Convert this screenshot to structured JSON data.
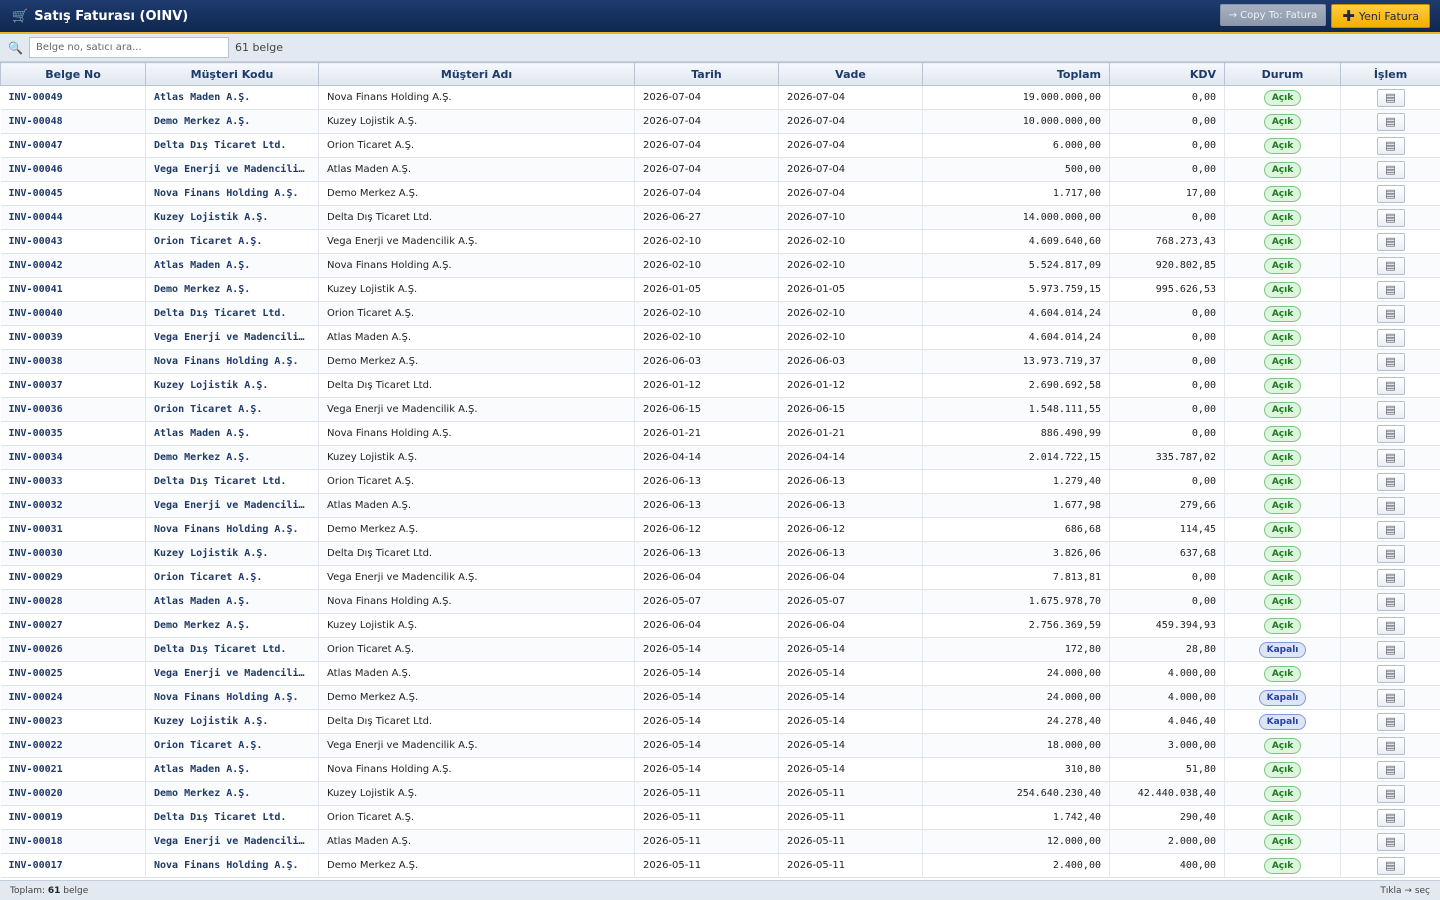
{
  "window": {
    "title": "Satış Faturası (OINV)"
  },
  "toolbar": {
    "copy_label": "→ Copy To: Fatura",
    "new_label": "Yeni Fatura"
  },
  "search": {
    "placeholder": "Belge no, satıcı ara...",
    "count": "61 belge"
  },
  "columns": [
    "Belge No",
    "Müşteri Kodu",
    "Müşteri Adı",
    "Tarih",
    "Vade",
    "Toplam",
    "KDV",
    "Durum",
    "İşlem"
  ],
  "rows": [
    {
      "no": "INV-00049",
      "code": "Atlas Maden A.Ş.",
      "name": "Nova Finans Holding A.Ş.",
      "date": "2026-07-04",
      "due": "2026-07-04",
      "total": "19.000.000,00",
      "vat": "0,00",
      "status": "Açık"
    },
    {
      "no": "INV-00048",
      "code": "Demo Merkez A.Ş.",
      "name": "Kuzey Lojistik A.Ş.",
      "date": "2026-07-04",
      "due": "2026-07-04",
      "total": "10.000.000,00",
      "vat": "0,00",
      "status": "Açık"
    },
    {
      "no": "INV-00047",
      "code": "Delta Dış Ticaret Ltd.",
      "name": "Orion Ticaret A.Ş.",
      "date": "2026-07-04",
      "due": "2026-07-04",
      "total": "6.000,00",
      "vat": "0,00",
      "status": "Açık"
    },
    {
      "no": "INV-00046",
      "code": "Vega Enerji ve Madencilik A.Ş.",
      "name": "Atlas Maden A.Ş.",
      "date": "2026-07-04",
      "due": "2026-07-04",
      "total": "500,00",
      "vat": "0,00",
      "status": "Açık"
    },
    {
      "no": "INV-00045",
      "code": "Nova Finans Holding A.Ş.",
      "name": "Demo Merkez A.Ş.",
      "date": "2026-07-04",
      "due": "2026-07-04",
      "total": "1.717,00",
      "vat": "17,00",
      "status": "Açık"
    },
    {
      "no": "INV-00044",
      "code": "Kuzey Lojistik A.Ş.",
      "name": "Delta Dış Ticaret Ltd.",
      "date": "2026-06-27",
      "due": "2026-07-10",
      "total": "14.000.000,00",
      "vat": "0,00",
      "status": "Açık"
    },
    {
      "no": "INV-00043",
      "code": "Orion Ticaret A.Ş.",
      "name": "Vega Enerji ve Madencilik A.Ş.",
      "date": "2026-02-10",
      "due": "2026-02-10",
      "total": "4.609.640,60",
      "vat": "768.273,43",
      "status": "Açık"
    },
    {
      "no": "INV-00042",
      "code": "Atlas Maden A.Ş.",
      "name": "Nova Finans Holding A.Ş.",
      "date": "2026-02-10",
      "due": "2026-02-10",
      "total": "5.524.817,09",
      "vat": "920.802,85",
      "status": "Açık"
    },
    {
      "no": "INV-00041",
      "code": "Demo Merkez A.Ş.",
      "name": "Kuzey Lojistik A.Ş.",
      "date": "2026-01-05",
      "due": "2026-01-05",
      "total": "5.973.759,15",
      "vat": "995.626,53",
      "status": "Açık"
    },
    {
      "no": "INV-00040",
      "code": "Delta Dış Ticaret Ltd.",
      "name": "Orion Ticaret A.Ş.",
      "date": "2026-02-10",
      "due": "2026-02-10",
      "total": "4.604.014,24",
      "vat": "0,00",
      "status": "Açık"
    },
    {
      "no": "INV-00039",
      "code": "Vega Enerji ve Madencilik A.Ş.",
      "name": "Atlas Maden A.Ş.",
      "date": "2026-02-10",
      "due": "2026-02-10",
      "total": "4.604.014,24",
      "vat": "0,00",
      "status": "Açık"
    },
    {
      "no": "INV-00038",
      "code": "Nova Finans Holding A.Ş.",
      "name": "Demo Merkez A.Ş.",
      "date": "2026-06-03",
      "due": "2026-06-03",
      "total": "13.973.719,37",
      "vat": "0,00",
      "status": "Açık"
    },
    {
      "no": "INV-00037",
      "code": "Kuzey Lojistik A.Ş.",
      "name": "Delta Dış Ticaret Ltd.",
      "date": "2026-01-12",
      "due": "2026-01-12",
      "total": "2.690.692,58",
      "vat": "0,00",
      "status": "Açık"
    },
    {
      "no": "INV-00036",
      "code": "Orion Ticaret A.Ş.",
      "name": "Vega Enerji ve Madencilik A.Ş.",
      "date": "2026-06-15",
      "due": "2026-06-15",
      "total": "1.548.111,55",
      "vat": "0,00",
      "status": "Açık"
    },
    {
      "no": "INV-00035",
      "code": "Atlas Maden A.Ş.",
      "name": "Nova Finans Holding A.Ş.",
      "date": "2026-01-21",
      "due": "2026-01-21",
      "total": "886.490,99",
      "vat": "0,00",
      "status": "Açık"
    },
    {
      "no": "INV-00034",
      "code": "Demo Merkez A.Ş.",
      "name": "Kuzey Lojistik A.Ş.",
      "date": "2026-04-14",
      "due": "2026-04-14",
      "total": "2.014.722,15",
      "vat": "335.787,02",
      "status": "Açık"
    },
    {
      "no": "INV-00033",
      "code": "Delta Dış Ticaret Ltd.",
      "name": "Orion Ticaret A.Ş.",
      "date": "2026-06-13",
      "due": "2026-06-13",
      "total": "1.279,40",
      "vat": "0,00",
      "status": "Açık"
    },
    {
      "no": "INV-00032",
      "code": "Vega Enerji ve Madencilik A.Ş.",
      "name": "Atlas Maden A.Ş.",
      "date": "2026-06-13",
      "due": "2026-06-13",
      "total": "1.677,98",
      "vat": "279,66",
      "status": "Açık"
    },
    {
      "no": "INV-00031",
      "code": "Nova Finans Holding A.Ş.",
      "name": "Demo Merkez A.Ş.",
      "date": "2026-06-12",
      "due": "2026-06-12",
      "total": "686,68",
      "vat": "114,45",
      "status": "Açık"
    },
    {
      "no": "INV-00030",
      "code": "Kuzey Lojistik A.Ş.",
      "name": "Delta Dış Ticaret Ltd.",
      "date": "2026-06-13",
      "due": "2026-06-13",
      "total": "3.826,06",
      "vat": "637,68",
      "status": "Açık"
    },
    {
      "no": "INV-00029",
      "code": "Orion Ticaret A.Ş.",
      "name": "Vega Enerji ve Madencilik A.Ş.",
      "date": "2026-06-04",
      "due": "2026-06-04",
      "total": "7.813,81",
      "vat": "0,00",
      "status": "Açık"
    },
    {
      "no": "INV-00028",
      "code": "Atlas Maden A.Ş.",
      "name": "Nova Finans Holding A.Ş.",
      "date": "2026-05-07",
      "due": "2026-05-07",
      "total": "1.675.978,70",
      "vat": "0,00",
      "status": "Açık"
    },
    {
      "no": "INV-00027",
      "code": "Demo Merkez A.Ş.",
      "name": "Kuzey Lojistik A.Ş.",
      "date": "2026-06-04",
      "due": "2026-06-04",
      "total": "2.756.369,59",
      "vat": "459.394,93",
      "status": "Açık"
    },
    {
      "no": "INV-00026",
      "code": "Delta Dış Ticaret Ltd.",
      "name": "Orion Ticaret A.Ş.",
      "date": "2026-05-14",
      "due": "2026-05-14",
      "total": "172,80",
      "vat": "28,80",
      "status": "Kapalı"
    },
    {
      "no": "INV-00025",
      "code": "Vega Enerji ve Madencilik A.Ş.",
      "name": "Atlas Maden A.Ş.",
      "date": "2026-05-14",
      "due": "2026-05-14",
      "total": "24.000,00",
      "vat": "4.000,00",
      "status": "Açık"
    },
    {
      "no": "INV-00024",
      "code": "Nova Finans Holding A.Ş.",
      "name": "Demo Merkez A.Ş.",
      "date": "2026-05-14",
      "due": "2026-05-14",
      "total": "24.000,00",
      "vat": "4.000,00",
      "status": "Kapalı"
    },
    {
      "no": "INV-00023",
      "code": "Kuzey Lojistik A.Ş.",
      "name": "Delta Dış Ticaret Ltd.",
      "date": "2026-05-14",
      "due": "2026-05-14",
      "total": "24.278,40",
      "vat": "4.046,40",
      "status": "Kapalı"
    },
    {
      "no": "INV-00022",
      "code": "Orion Ticaret A.Ş.",
      "name": "Vega Enerji ve Madencilik A.Ş.",
      "date": "2026-05-14",
      "due": "2026-05-14",
      "total": "18.000,00",
      "vat": "3.000,00",
      "status": "Açık"
    },
    {
      "no": "INV-00021",
      "code": "Atlas Maden A.Ş.",
      "name": "Nova Finans Holding A.Ş.",
      "date": "2026-05-14",
      "due": "2026-05-14",
      "total": "310,80",
      "vat": "51,80",
      "status": "Açık"
    },
    {
      "no": "INV-00020",
      "code": "Demo Merkez A.Ş.",
      "name": "Kuzey Lojistik A.Ş.",
      "date": "2026-05-11",
      "due": "2026-05-11",
      "total": "254.640.230,40",
      "vat": "42.440.038,40",
      "status": "Açık"
    },
    {
      "no": "INV-00019",
      "code": "Delta Dış Ticaret Ltd.",
      "name": "Orion Ticaret A.Ş.",
      "date": "2026-05-11",
      "due": "2026-05-11",
      "total": "1.742,40",
      "vat": "290,40",
      "status": "Açık"
    },
    {
      "no": "INV-00018",
      "code": "Vega Enerji ve Madencilik A.Ş.",
      "name": "Atlas Maden A.Ş.",
      "date": "2026-05-11",
      "due": "2026-05-11",
      "total": "12.000,00",
      "vat": "2.000,00",
      "status": "Açık"
    },
    {
      "no": "INV-00017",
      "code": "Nova Finans Holding A.Ş.",
      "name": "Demo Merkez A.Ş.",
      "date": "2026-05-11",
      "due": "2026-05-11",
      "total": "2.400,00",
      "vat": "400,00",
      "status": "Açık"
    }
  ],
  "footer": {
    "total_prefix": "Toplam:",
    "total_count": "61",
    "total_suffix": "belge",
    "hint": "Tıkla → seç"
  },
  "colors": {
    "header_bg": "#10284f",
    "accent": "#f0b428",
    "open": "#1f7a1f",
    "closed": "#2443a0"
  }
}
